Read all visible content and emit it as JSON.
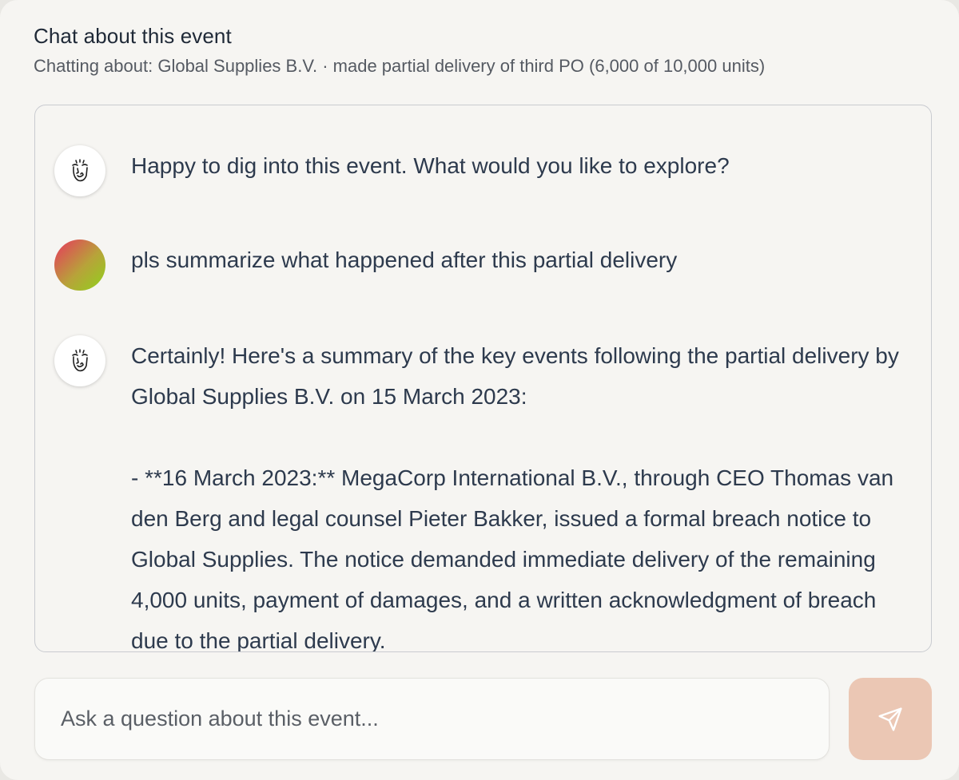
{
  "header": {
    "title": "Chat about this event",
    "subtitle": "Chatting about: Global Supplies B.V. · made partial delivery of third PO (6,000 of 10,000 units)"
  },
  "messages": [
    {
      "role": "assistant",
      "avatar_icon": "assistant-face-icon",
      "text": "Happy to dig into this event. What would you like to explore?"
    },
    {
      "role": "user",
      "avatar_icon": "user-gradient-avatar",
      "text": "pls summarize what happened after this partial delivery"
    },
    {
      "role": "assistant",
      "avatar_icon": "assistant-face-icon",
      "text": "Certainly! Here's a summary of the key events following the partial delivery by Global Supplies B.V. on 15 March 2023:\n\n- **16 March 2023:** MegaCorp International B.V., through CEO Thomas van den Berg and legal counsel Pieter Bakker, issued a formal breach notice to Global Supplies. The notice demanded immediate delivery of the remaining 4,000 units, payment of damages, and a written acknowledgment of breach due to the partial delivery."
    }
  ],
  "composer": {
    "placeholder": "Ask a question about this event...",
    "send_icon": "send-icon"
  },
  "colors": {
    "panel_bg": "#f6f5f2",
    "text": "#2d3a4d",
    "send_button_bg": "#ebc7b4"
  }
}
